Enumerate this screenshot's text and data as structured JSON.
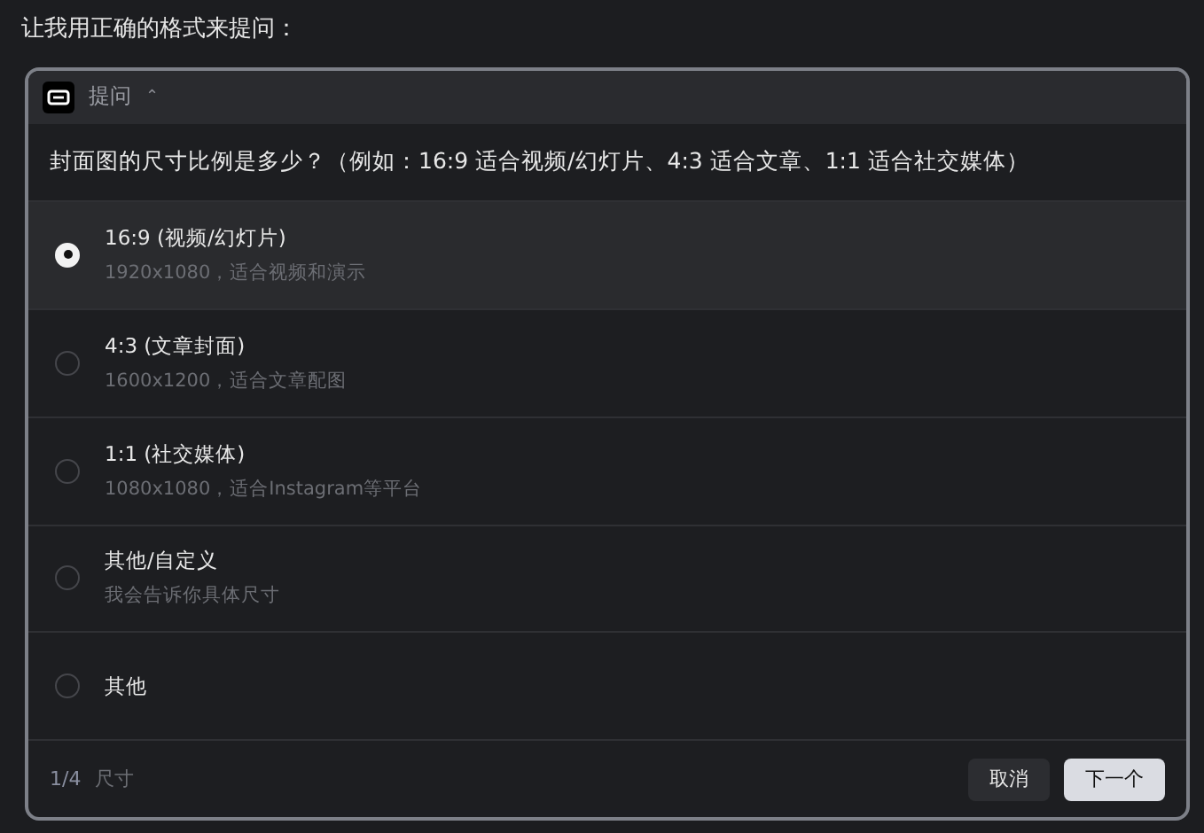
{
  "intro": "让我用正确的格式来提问：",
  "card": {
    "title": "提问",
    "collapse_icon": "⌃",
    "question": "封面图的尺寸比例是多少？（例如：16:9 适合视频/幻灯片、4:3 适合文章、1:1 适合社交媒体）",
    "options": [
      {
        "label": "16:9 (视频/幻灯片)",
        "description": "1920x1080，适合视频和演示",
        "selected": true
      },
      {
        "label": "4:3 (文章封面)",
        "description": "1600x1200，适合文章配图",
        "selected": false
      },
      {
        "label": "1:1 (社交媒体)",
        "description": "1080x1080，适合Instagram等平台",
        "selected": false
      },
      {
        "label": "其他/自定义",
        "description": "我会告诉你具体尺寸",
        "selected": false
      },
      {
        "label": "其他",
        "selected": false
      }
    ],
    "step": "1/4",
    "step_label": "尺寸",
    "buttons": [
      {
        "label": "取消",
        "kind": "secondary"
      },
      {
        "label": "下一个",
        "kind": "primary"
      }
    ]
  }
}
